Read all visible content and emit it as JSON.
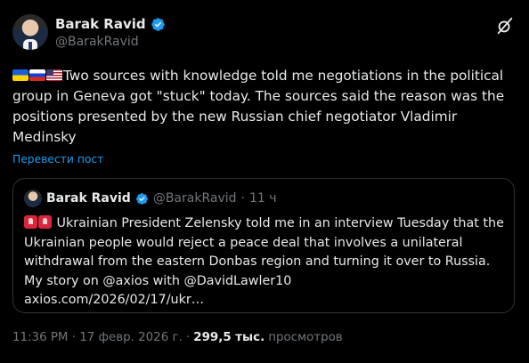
{
  "author": {
    "name": "Barak Ravid",
    "handle": "@BarakRavid"
  },
  "post": {
    "text": "Two sources with knowledge told me negotiations in the political group in Geneva got \"stuck\" today. The sources said the reason was the positions presented by the new Russian chief negotiator Vladimir Medinsky",
    "flags": [
      "ukraine-flag-icon",
      "russia-flag-icon",
      "usa-flag-icon"
    ],
    "translate_label": "Перевести пост"
  },
  "quote": {
    "name": "Barak Ravid",
    "handle": "@BarakRavid",
    "separator": "·",
    "time": "11 ч",
    "text_line1": "Ukrainian President Zelensky told me in an interview Tuesday that the",
    "text_rest": "Ukrainian people would reject a peace deal that involves a unilateral withdrawal from the eastern Donbas region and turning it over to Russia. My story on @axios with @DavidLawler10",
    "link": "axios.com/2026/02/17/ukr…"
  },
  "meta": {
    "time": "11:36 PM · 17 февр. 2026 г. ·",
    "views_count": "299,5 тыс.",
    "views_label": "просмотров"
  },
  "colors": {
    "background": "#000000",
    "text": "#e7e9ea",
    "secondary": "#71767b",
    "accent": "#1d9bf0",
    "border": "#2f3336"
  }
}
